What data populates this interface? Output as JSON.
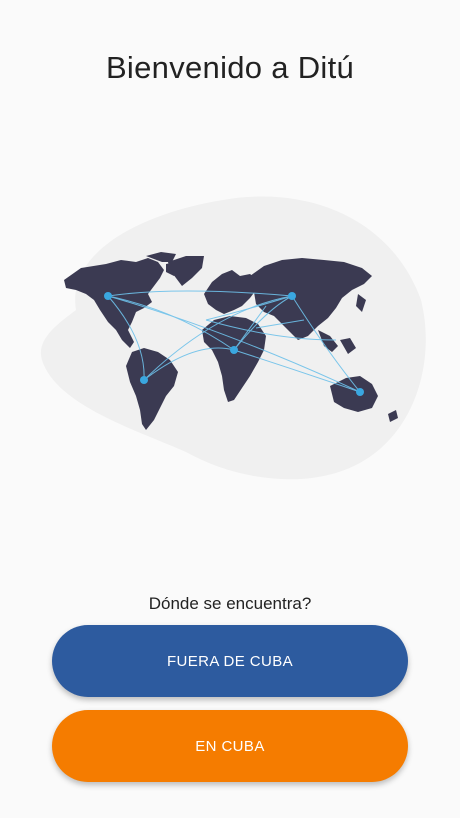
{
  "header": {
    "title": "Bienvenido a Ditú"
  },
  "illustration": {
    "icon": "world-map-network-icon",
    "blob_color": "#f0f0f0",
    "land_color": "#3b3a52",
    "node_color": "#3aa7e0"
  },
  "location_prompt": {
    "question": "Dónde se encuentra?"
  },
  "buttons": {
    "outside": {
      "label": "FUERA DE CUBA",
      "color": "#2d5b9f"
    },
    "inside": {
      "label": "EN CUBA",
      "color": "#f57c00"
    }
  }
}
